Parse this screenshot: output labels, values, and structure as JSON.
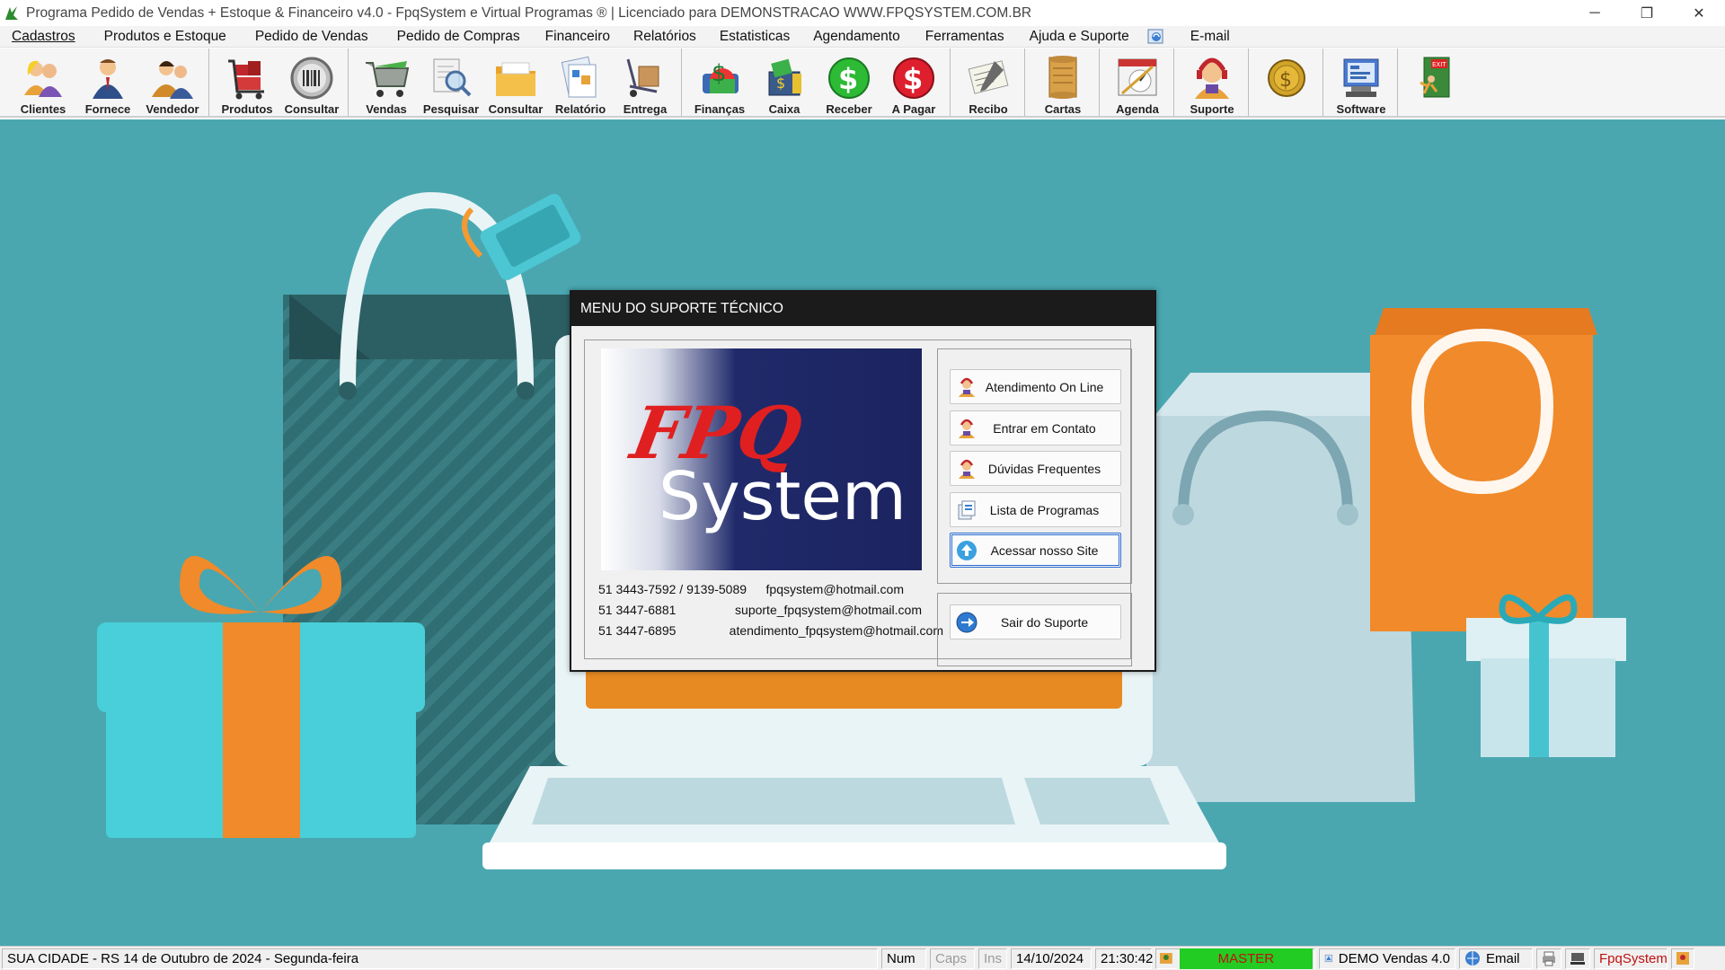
{
  "window": {
    "title": "Programa Pedido de Vendas + Estoque & Financeiro v4.0 - FpqSystem e Virtual Programas ® | Licenciado para  DEMONSTRACAO WWW.FPQSYSTEM.COM.BR",
    "controls": [
      "─",
      "❐",
      "✕"
    ]
  },
  "menu": {
    "items": [
      {
        "label": "Cadastros"
      },
      {
        "label": "Produtos e Estoque"
      },
      {
        "label": "Pedido de Vendas"
      },
      {
        "label": "Pedido de Compras"
      },
      {
        "label": "Financeiro"
      },
      {
        "label": "Relatórios"
      },
      {
        "label": "Estatisticas"
      },
      {
        "label": "Agendamento"
      },
      {
        "label": "Ferramentas"
      },
      {
        "label": "Ajuda e Suporte"
      },
      {
        "label": "E-mail"
      }
    ]
  },
  "toolbar": {
    "buttons": [
      {
        "label": "Clientes",
        "icon": "clients-icon"
      },
      {
        "label": "Fornece",
        "icon": "supplier-icon"
      },
      {
        "label": "Vendedor",
        "icon": "seller-icon"
      },
      {
        "label": "Produtos",
        "icon": "products-icon"
      },
      {
        "label": "Consultar",
        "icon": "barcode-icon"
      },
      {
        "label": "Vendas",
        "icon": "cart-icon"
      },
      {
        "label": "Pesquisar",
        "icon": "search-icon"
      },
      {
        "label": "Consultar",
        "icon": "folder-icon"
      },
      {
        "label": "Relatório",
        "icon": "report-icon"
      },
      {
        "label": "Entrega",
        "icon": "delivery-icon"
      },
      {
        "label": "Finanças",
        "icon": "finance-icon"
      },
      {
        "label": "Caixa",
        "icon": "cashbox-icon"
      },
      {
        "label": "Receber",
        "icon": "receive-icon"
      },
      {
        "label": "A Pagar",
        "icon": "pay-icon"
      },
      {
        "label": "Recibo",
        "icon": "receipt-icon"
      },
      {
        "label": "Cartas",
        "icon": "letters-icon"
      },
      {
        "label": "Agenda",
        "icon": "calendar-icon"
      },
      {
        "label": "Suporte",
        "icon": "support-icon"
      },
      {
        "label": "",
        "icon": "coin-icon"
      },
      {
        "label": "Software",
        "icon": "software-icon"
      },
      {
        "label": "",
        "icon": "exit-icon"
      }
    ]
  },
  "dialog": {
    "title": "MENU DO SUPORTE TÉCNICO",
    "logo": {
      "line1": "FPQ",
      "line2": "System"
    },
    "contacts": [
      {
        "phone": "51 3443-7592 / 9139-5089",
        "email": "fpqsystem@hotmail.com"
      },
      {
        "phone": "51 3447-6881",
        "email": "suporte_fpqsystem@hotmail.com"
      },
      {
        "phone": "51 3447-6895",
        "email": "atendimento_fpqsystem@hotmail.com"
      }
    ],
    "buttons": [
      {
        "label": "Atendimento On Line"
      },
      {
        "label": "Entrar em Contato"
      },
      {
        "label": "Dúvidas Frequentes"
      },
      {
        "label": "Lista de Programas"
      },
      {
        "label": "Acessar nosso Site"
      }
    ],
    "exit_label": "Sair do Suporte"
  },
  "status": {
    "location_date": "SUA CIDADE - RS 14 de Outubro de 2024 - Segunda-feira",
    "num": "Num",
    "caps": "Caps",
    "ins": "Ins",
    "date": "14/10/2024",
    "time": "21:30:42",
    "user": "MASTER",
    "version": "DEMO Vendas 4.0",
    "email": "Email",
    "brand": "FpqSystem"
  },
  "colors": {
    "desktop_bg": "#4aa7b0",
    "dialog_title_bg": "#1b1b1b",
    "master_bg": "#22cc22",
    "brand_red": "#c01010"
  }
}
